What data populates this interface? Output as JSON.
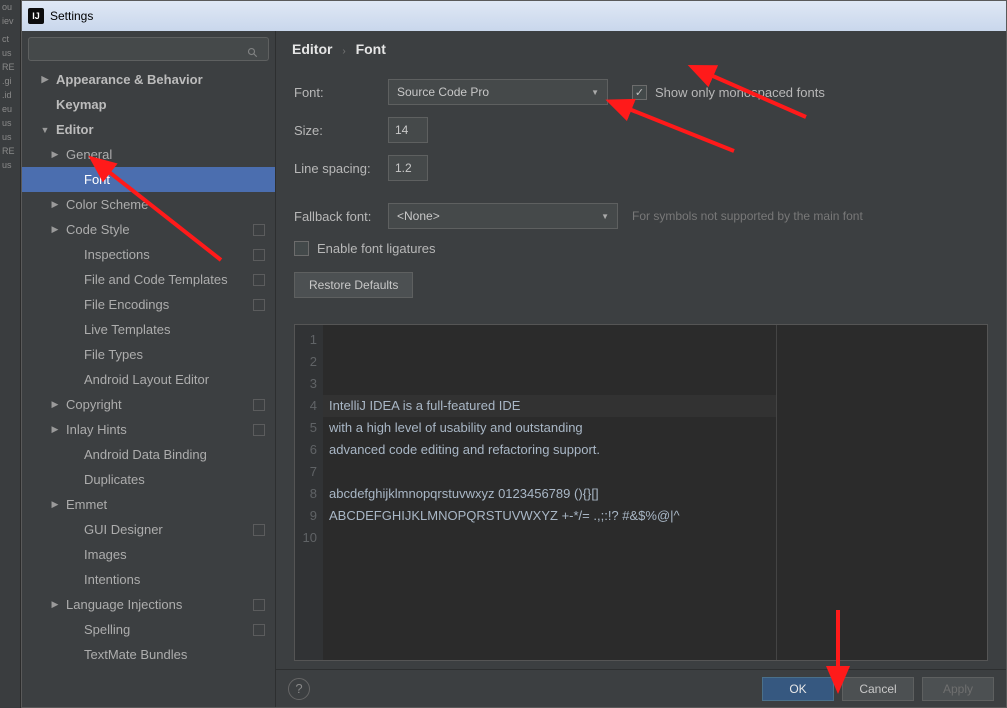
{
  "window": {
    "title": "Settings"
  },
  "fringe": [
    "ou",
    "iev",
    "",
    "ct",
    "us",
    "RE",
    ".gi",
    ".id",
    "eu",
    "us",
    "us",
    "RE",
    "us"
  ],
  "search": {
    "placeholder": ""
  },
  "tree": [
    {
      "label": "Appearance & Behavior",
      "level": 0,
      "arrow": "right",
      "bold": true
    },
    {
      "label": "Keymap",
      "level": 0,
      "arrow": "",
      "bold": true
    },
    {
      "label": "Editor",
      "level": 0,
      "arrow": "down",
      "bold": true
    },
    {
      "label": "General",
      "level": 1,
      "arrow": "right"
    },
    {
      "label": "Font",
      "level": 2,
      "arrow": "",
      "sel": true
    },
    {
      "label": "Color Scheme",
      "level": 1,
      "arrow": "right"
    },
    {
      "label": "Code Style",
      "level": 1,
      "arrow": "right",
      "sq": true
    },
    {
      "label": "Inspections",
      "level": 2,
      "arrow": "",
      "sq": true
    },
    {
      "label": "File and Code Templates",
      "level": 2,
      "arrow": "",
      "sq": true
    },
    {
      "label": "File Encodings",
      "level": 2,
      "arrow": "",
      "sq": true
    },
    {
      "label": "Live Templates",
      "level": 2,
      "arrow": ""
    },
    {
      "label": "File Types",
      "level": 2,
      "arrow": ""
    },
    {
      "label": "Android Layout Editor",
      "level": 2,
      "arrow": ""
    },
    {
      "label": "Copyright",
      "level": 1,
      "arrow": "right",
      "sq": true
    },
    {
      "label": "Inlay Hints",
      "level": 1,
      "arrow": "right",
      "sq": true
    },
    {
      "label": "Android Data Binding",
      "level": 2,
      "arrow": ""
    },
    {
      "label": "Duplicates",
      "level": 2,
      "arrow": ""
    },
    {
      "label": "Emmet",
      "level": 1,
      "arrow": "right"
    },
    {
      "label": "GUI Designer",
      "level": 2,
      "arrow": "",
      "sq": true
    },
    {
      "label": "Images",
      "level": 2,
      "arrow": ""
    },
    {
      "label": "Intentions",
      "level": 2,
      "arrow": ""
    },
    {
      "label": "Language Injections",
      "level": 1,
      "arrow": "right",
      "sq": true
    },
    {
      "label": "Spelling",
      "level": 2,
      "arrow": "",
      "sq": true
    },
    {
      "label": "TextMate Bundles",
      "level": 2,
      "arrow": ""
    }
  ],
  "breadcrumb": {
    "a": "Editor",
    "b": "Font"
  },
  "form": {
    "font_label": "Font:",
    "font_value": "Source Code Pro",
    "mono_check": "Show only monospaced fonts",
    "mono_checked": true,
    "size_label": "Size:",
    "size_value": "14",
    "spacing_label": "Line spacing:",
    "spacing_value": "1.2",
    "fallback_label": "Fallback font:",
    "fallback_value": "<None>",
    "fallback_hint": "For symbols not supported by the main font",
    "ligatures": "Enable font ligatures",
    "restore": "Restore Defaults"
  },
  "preview_lines": [
    "IntelliJ IDEA is a full-featured IDE",
    "with a high level of usability and outstanding",
    "advanced code editing and refactoring support.",
    "",
    "abcdefghijklmnopqrstuvwxyz 0123456789 (){}[]",
    "ABCDEFGHIJKLMNOPQRSTUVWXYZ +-*/= .,;:!? #&$%@|^",
    "",
    "",
    "",
    ""
  ],
  "buttons": {
    "ok": "OK",
    "cancel": "Cancel",
    "apply": "Apply"
  }
}
